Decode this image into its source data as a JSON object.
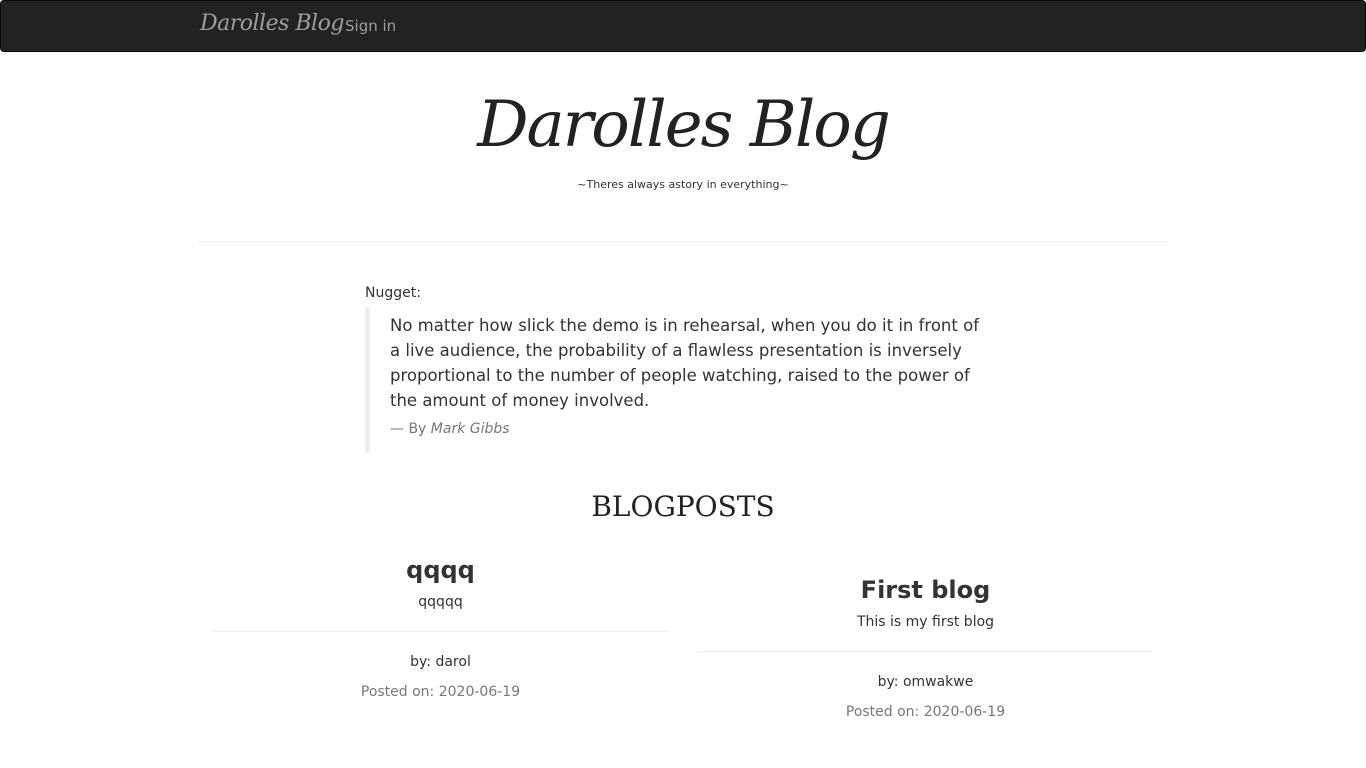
{
  "navbar": {
    "brand": "Darolles Blog",
    "sign_in": "Sign in"
  },
  "header": {
    "title": "Darolles Blog",
    "tagline": "~Theres always astory in everything~"
  },
  "nugget": {
    "label": "Nugget:",
    "quote": "No matter how slick the demo is in rehearsal, when you do it in front of a live audience, the probability of a flawless presentation is inversely proportional to the number of people watching, raised to the power of the amount of money involved.",
    "by_prefix": "— By",
    "author": "Mark Gibbs"
  },
  "blogposts": {
    "heading": "BLOGPOSTS",
    "posts": [
      {
        "title": "qqqq",
        "body": "qqqqq",
        "author": "by: darol",
        "date_label": "Posted on:",
        "date": "2020-06-19"
      },
      {
        "title": "First blog",
        "body": "This is my first blog",
        "author": "by: omwakwe",
        "date_label": "Posted on:",
        "date": "2020-06-19"
      }
    ]
  }
}
